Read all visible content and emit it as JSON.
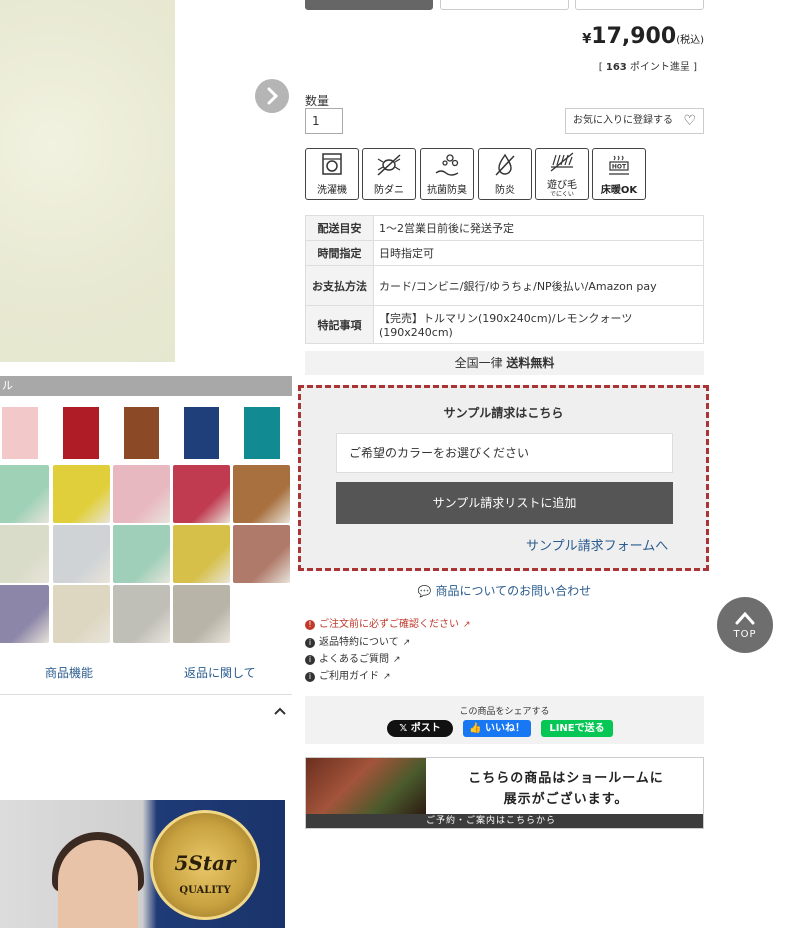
{
  "price": {
    "yen": "¥",
    "amount": "17,900",
    "tax": "(税込)",
    "points_prefix": "[ ",
    "points_value": "163",
    "points_suffix": " ポイント進呈 ]"
  },
  "quantity": {
    "label": "数量",
    "value": "1"
  },
  "favorite": {
    "label": "お気に入りに登録する"
  },
  "features": [
    {
      "label": "洗濯機",
      "icon": "washing-machine-icon"
    },
    {
      "label": "防ダニ",
      "icon": "mite-icon"
    },
    {
      "label": "抗菌防臭",
      "icon": "antibacterial-icon"
    },
    {
      "label": "防炎",
      "icon": "flame-icon"
    },
    {
      "label": "遊び毛",
      "sub": "でにくい",
      "icon": "fluff-icon"
    },
    {
      "label": "床暖OK",
      "badge": "HOT",
      "icon": "floor-heating-icon"
    }
  ],
  "spec": [
    {
      "head": "配送目安",
      "value": "1〜2営業日前後に発送予定"
    },
    {
      "head": "時間指定",
      "value": "日時指定可"
    },
    {
      "head": "お支払方法",
      "value": "カード/コンビニ/銀行/ゆうちょ/NP後払い/Amazon pay"
    },
    {
      "head": "特記事項",
      "value": "【完売】トルマリン(190x240cm)/レモンクォーツ(190x240cm)"
    }
  ],
  "shipping": {
    "prefix": "全国一律 ",
    "bold": "送料無料"
  },
  "sample": {
    "title": "サンプル請求はこちら",
    "select_placeholder": "ご希望のカラーをお選びください",
    "add_label": "サンプル請求リストに追加",
    "form_link": "サンプル請求フォームへ"
  },
  "inquiry": "商品についてのお問い合わせ",
  "info_links": [
    {
      "label": "ご注文前に必ずご確認ください",
      "color": "#c0392b"
    },
    {
      "label": "返品特約について",
      "color": "#333333"
    },
    {
      "label": "よくあるご質問",
      "color": "#333333"
    },
    {
      "label": "ご利用ガイド",
      "color": "#333333"
    }
  ],
  "share": {
    "title": "この商品をシェアする",
    "x_label": "𝕏 ポスト",
    "like_label": "👍 いいね！",
    "line_label": "LINEで送る"
  },
  "showroom": {
    "line1": "こちらの商品はショールームに",
    "line2": "展示がございます。",
    "footer": "ご予約・ご案内はこちらから"
  },
  "left": {
    "color_bar": "ル",
    "links": [
      "商品機能",
      "返品に関して"
    ],
    "swatch_colors": [
      "#f2c8c8",
      "#b01c25",
      "#8b4a25",
      "#1e3f7a",
      "#118a92"
    ],
    "thumb_colors": [
      "#9fd1b7",
      "#e0cf3a",
      "#e8b8c0",
      "#c03a50",
      "#a8703f",
      "#d9dcc8",
      "#cfd3d6",
      "#9fcfb9",
      "#d6c04a",
      "#b07a6a",
      "#8c86a8",
      "#ddd7c2",
      "#bfbfb8",
      "#b8b4a8"
    ],
    "medal_line1": "5Star",
    "medal_line2": "QUALITY"
  },
  "top_button": "TOP"
}
